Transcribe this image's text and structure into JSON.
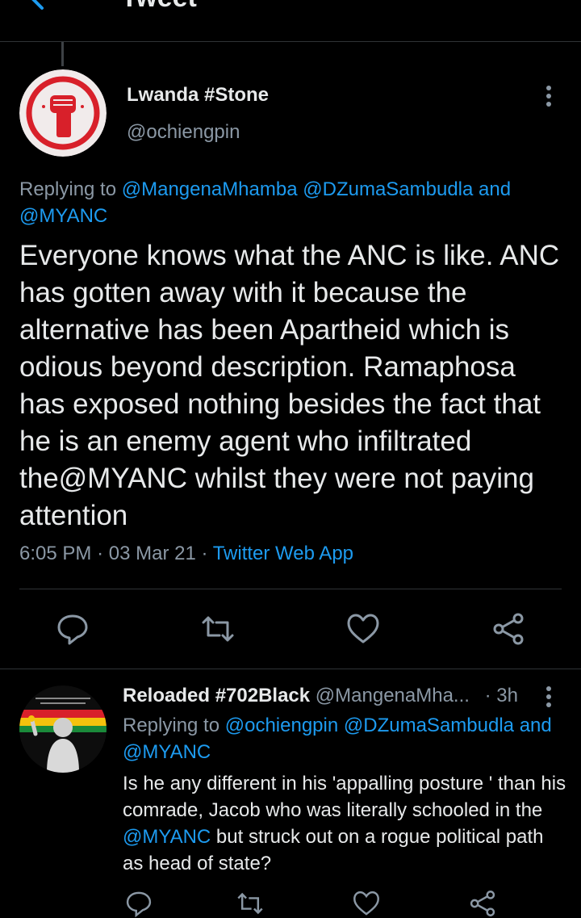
{
  "header": {
    "title": "Tweet",
    "back_icon": "arrow-left-icon"
  },
  "tweet": {
    "author_name": "Lwanda #Stone",
    "author_handle": "@ochiengpin",
    "replying_prefix": "Replying to ",
    "replying_to": [
      "@MangenaMhamba",
      "@DZumaSambudla",
      "@MYANC"
    ],
    "replying_and": "and",
    "text": "Everyone knows what the ANC is like. ANC has gotten away with it because the alternative has been Apartheid which is odious beyond description. Ramaphosa has exposed nothing besides the fact that he is an enemy agent who infiltrated the@MYANC whilst they were not paying attention",
    "time": "6:05 PM",
    "date": "03 Mar 21",
    "separator": "·",
    "source": "Twitter Web App",
    "actions": [
      "reply-icon",
      "retweet-icon",
      "like-icon",
      "share-icon"
    ]
  },
  "reply": {
    "author_name": "Reloaded #702Black",
    "author_handle": "@MangenaMha...",
    "age": "· 3h",
    "replying_prefix": "Replying to ",
    "replying_to": [
      "@ochiengpin",
      "@DZumaSambudla",
      "@MYANC"
    ],
    "replying_and": "and",
    "text_before": "Is he any different in his 'appalling posture ' than his comrade, Jacob who was literally schooled in the ",
    "text_mention": "@MYANC",
    "text_after": " but struck out on a rogue political path as head of state?"
  },
  "colors": {
    "background": "#000000",
    "link": "#1d9bf0",
    "secondary_text": "#8b98a5",
    "avatar_red": "#d8202a"
  }
}
